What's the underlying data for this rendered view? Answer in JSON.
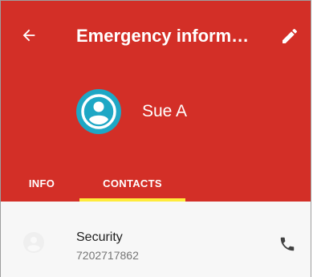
{
  "toolbar": {
    "back_icon": "arrow-back-icon",
    "title": "Emergency inform…",
    "edit_icon": "pencil-icon"
  },
  "profile": {
    "avatar_icon": "account-circle-icon",
    "name": "Sue A"
  },
  "tabs": [
    {
      "label": "INFO",
      "selected": false
    },
    {
      "label": "CONTACTS",
      "selected": true
    }
  ],
  "contacts": [
    {
      "name": "Security",
      "number": "7202717862",
      "avatar_icon": "account-circle-icon",
      "action_icon": "phone-icon"
    }
  ],
  "colors": {
    "header": "#d32f27",
    "tab_indicator": "#ffeb3b",
    "avatar": "#1ea7c5",
    "list_background": "#f7f7f7"
  }
}
